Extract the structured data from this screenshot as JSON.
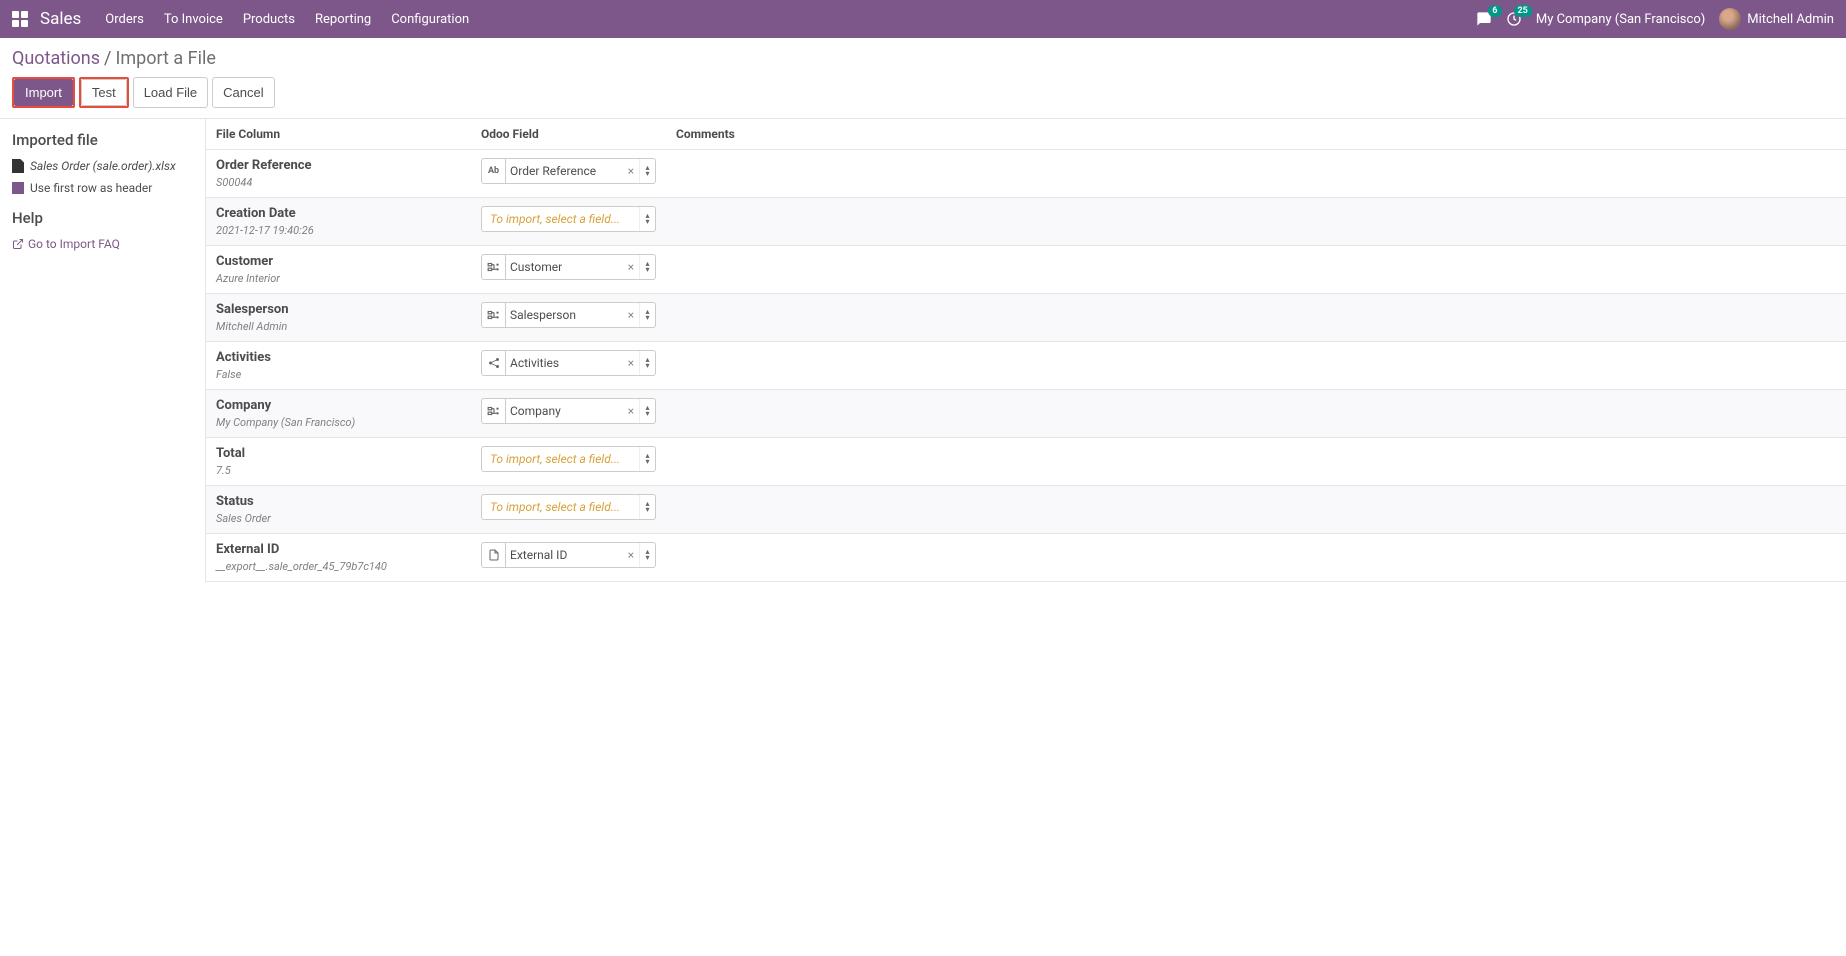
{
  "navbar": {
    "app_title": "Sales",
    "menu": [
      "Orders",
      "To Invoice",
      "Products",
      "Reporting",
      "Configuration"
    ],
    "msg_count": "6",
    "activity_count": "25",
    "company": "My Company (San Francisco)",
    "user": "Mitchell Admin"
  },
  "breadcrumb": {
    "link": "Quotations",
    "current": "Import a File"
  },
  "buttons": {
    "import": "Import",
    "test": "Test",
    "load": "Load File",
    "cancel": "Cancel"
  },
  "sidebar": {
    "imported_file_title": "Imported file",
    "filename": "Sales Order (sale.order).xlsx",
    "first_row_label": "Use first row as header",
    "help_title": "Help",
    "faq_link": "Go to Import FAQ"
  },
  "table": {
    "headers": {
      "file_col": "File Column",
      "odoo_field": "Odoo Field",
      "comments": "Comments"
    },
    "rows": [
      {
        "label": "Order Reference",
        "sample": "S00044",
        "field": "Order Reference",
        "icon": "Ab",
        "has_value": true
      },
      {
        "label": "Creation Date",
        "sample": "2021-12-17 19:40:26",
        "field": "To import, select a field...",
        "icon": "",
        "has_value": false
      },
      {
        "label": "Customer",
        "sample": "Azure Interior",
        "field": "Customer",
        "icon": "rel",
        "has_value": true
      },
      {
        "label": "Salesperson",
        "sample": "Mitchell Admin",
        "field": "Salesperson",
        "icon": "rel",
        "has_value": true
      },
      {
        "label": "Activities",
        "sample": "False",
        "field": "Activities",
        "icon": "share",
        "has_value": true
      },
      {
        "label": "Company",
        "sample": "My Company (San Francisco)",
        "field": "Company",
        "icon": "rel",
        "has_value": true
      },
      {
        "label": "Total",
        "sample": "7.5",
        "field": "To import, select a field...",
        "icon": "",
        "has_value": false
      },
      {
        "label": "Status",
        "sample": "Sales Order",
        "field": "To import, select a field...",
        "icon": "",
        "has_value": false
      },
      {
        "label": "External ID",
        "sample": "__export__.sale_order_45_79b7c140",
        "field": "External ID",
        "icon": "file",
        "has_value": true
      }
    ]
  }
}
